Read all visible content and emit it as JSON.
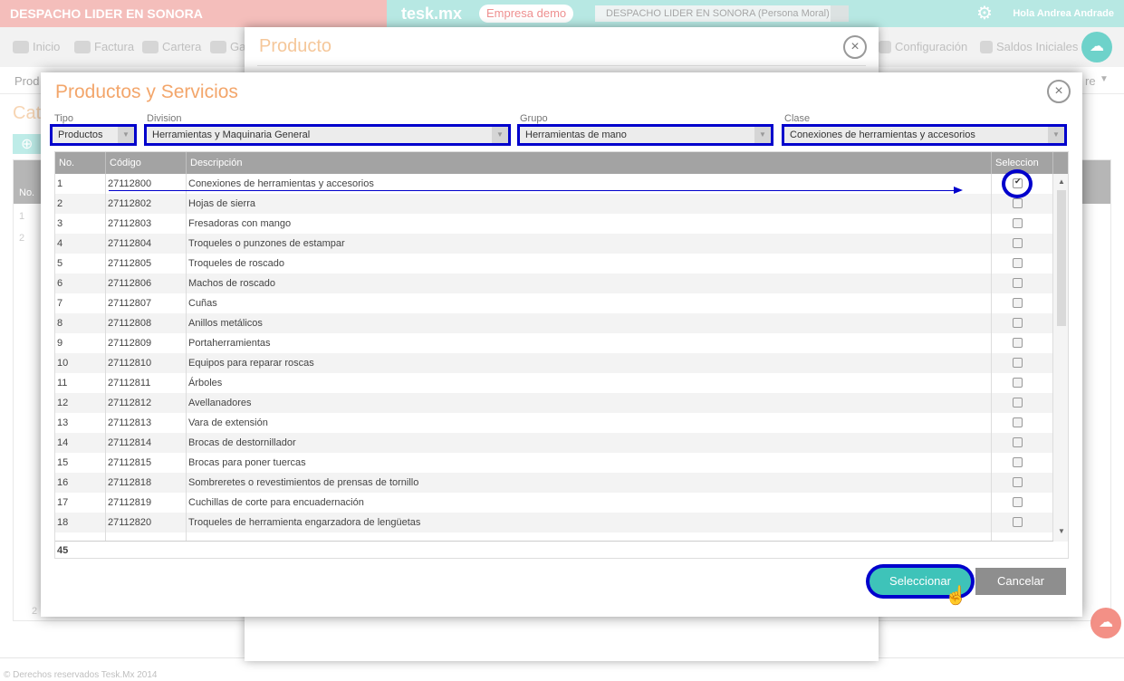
{
  "topbar": {
    "company_left": "DESPACHO LIDER EN SONORA",
    "brand": "tesk.mx",
    "demo_badge": "Empresa demo",
    "company_select": "DESPACHO LIDER EN SONORA  (Persona Moral)",
    "greeting": "Hola Andrea Andrade"
  },
  "nav": {
    "inicio": "Inicio",
    "factura": "Factura",
    "cartera": "Cartera",
    "ga": "Ga",
    "configuracion": "Configuración",
    "saldos": "Saldos Iniciales"
  },
  "background": {
    "subnav_left": "Prod",
    "subnav_right": "re",
    "page_title": "Cat",
    "no_header": "No.",
    "row1": "1",
    "row2": "2",
    "foot_num": "2",
    "footer_text": "© Derechos reservados Tesk.Mx 2014"
  },
  "product_dialog": {
    "title": "Producto"
  },
  "dialog": {
    "title": "Productos y Servicios",
    "filters": {
      "tipo_label": "Tipo",
      "tipo_value": "Productos",
      "division_label": "Division",
      "division_value": "Herramientas y Maquinaria General",
      "grupo_label": "Grupo",
      "grupo_value": "Herramientas de mano",
      "clase_label": "Clase",
      "clase_value": "Conexiones de herramientas y accesorios"
    },
    "columns": {
      "no": "No.",
      "codigo": "Código",
      "descripcion": "Descripción",
      "seleccion": "Seleccion"
    },
    "rows": [
      {
        "no": "1",
        "codigo": "27112800",
        "descripcion": "Conexiones de herramientas y accesorios",
        "checked": true
      },
      {
        "no": "2",
        "codigo": "27112802",
        "descripcion": "Hojas de sierra",
        "checked": false
      },
      {
        "no": "3",
        "codigo": "27112803",
        "descripcion": "Fresadoras con mango",
        "checked": false
      },
      {
        "no": "4",
        "codigo": "27112804",
        "descripcion": "Troqueles o punzones de estampar",
        "checked": false
      },
      {
        "no": "5",
        "codigo": "27112805",
        "descripcion": "Troqueles de roscado",
        "checked": false
      },
      {
        "no": "6",
        "codigo": "27112806",
        "descripcion": "Machos de roscado",
        "checked": false
      },
      {
        "no": "7",
        "codigo": "27112807",
        "descripcion": "Cuñas",
        "checked": false
      },
      {
        "no": "8",
        "codigo": "27112808",
        "descripcion": "Anillos metálicos",
        "checked": false
      },
      {
        "no": "9",
        "codigo": "27112809",
        "descripcion": "Portaherramientas",
        "checked": false
      },
      {
        "no": "10",
        "codigo": "27112810",
        "descripcion": "Equipos para reparar roscas",
        "checked": false
      },
      {
        "no": "11",
        "codigo": "27112811",
        "descripcion": "Árboles",
        "checked": false
      },
      {
        "no": "12",
        "codigo": "27112812",
        "descripcion": "Avellanadores",
        "checked": false
      },
      {
        "no": "13",
        "codigo": "27112813",
        "descripcion": "Vara de extensión",
        "checked": false
      },
      {
        "no": "14",
        "codigo": "27112814",
        "descripcion": "Brocas de destornillador",
        "checked": false
      },
      {
        "no": "15",
        "codigo": "27112815",
        "descripcion": "Brocas para poner tuercas",
        "checked": false
      },
      {
        "no": "16",
        "codigo": "27112818",
        "descripcion": "Sombreretes o revestimientos de prensas de tornillo",
        "checked": false
      },
      {
        "no": "17",
        "codigo": "27112819",
        "descripcion": "Cuchillas de corte para encuadernación",
        "checked": false
      },
      {
        "no": "18",
        "codigo": "27112820",
        "descripcion": "Troqueles de herramienta engarzadora de lengüetas",
        "checked": false
      }
    ],
    "total": "45",
    "buttons": {
      "select": "Seleccionar",
      "cancel": "Cancelar"
    }
  },
  "colors": {
    "accent_teal": "#3ec3b9",
    "header_pink": "#f0a9a5",
    "annotation_blue": "#0000cc",
    "title_orange": "#f3a66b"
  }
}
